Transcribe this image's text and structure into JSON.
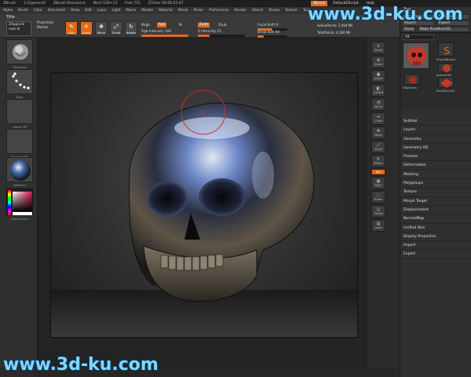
{
  "app": {
    "title_segments": [
      "ZBrush",
      "3.1[general]",
      "ZBrush Document",
      "Mem 539+13",
      "Free 751",
      "ZTimer 00:00:03.87"
    ],
    "menus_button": "Menus",
    "default_script": "DefaultZScript",
    "help": "Help"
  },
  "menubar": {
    "items": [
      "Alpha",
      "Brush",
      "Color",
      "Document",
      "Draw",
      "Edit",
      "Layer",
      "Light",
      "Macro",
      "Marker",
      "Material",
      "Movie",
      "Picker",
      "Preferences",
      "Render",
      "Stencil",
      "Stroke",
      "Texture",
      "Tool"
    ]
  },
  "shelf": {
    "title": "Title",
    "zapp_line1": "ZAppLink",
    "zapp_line2": "new dl",
    "proj_line1": "Projection",
    "proj_line2": "Master",
    "buttons": [
      {
        "label": "Edit",
        "icon": "✎",
        "active": true
      },
      {
        "label": "Draw",
        "icon": "✛",
        "active": true
      },
      {
        "label": "Move",
        "icon": "✥",
        "active": false
      },
      {
        "label": "Scale",
        "icon": "⤢",
        "active": false
      },
      {
        "label": "Rotate",
        "icon": "↻",
        "active": false
      }
    ],
    "mrgb": "Mrgb",
    "rgb": "Rgb",
    "m": "M",
    "rgb_intensity": "Rgb Intensity 100",
    "zadd": "Zadd",
    "zsub": "Zsub",
    "z_intensity": "Z Intensity 25",
    "focal_shift": "Focal Shift 0",
    "draw_size": "Draw Size 64",
    "active_points": "ActivePoints: 2.004 Mil",
    "total_points": "TotalPoints: 4.280 Mil"
  },
  "left_tray": {
    "tiles": [
      "Standard",
      "Dots",
      "Alpha Off",
      "Texture Off",
      "Material"
    ],
    "switch_color": "SwitchColor"
  },
  "right_shelf": {
    "buttons": [
      {
        "label": "Scroll",
        "icon": "⇕"
      },
      {
        "label": "Zoom",
        "icon": "⊕"
      },
      {
        "label": "Actual",
        "icon": "▣"
      },
      {
        "label": "AAHalf",
        "icon": "◧"
      },
      {
        "label": "Persp",
        "icon": "◔"
      },
      {
        "label": "L.Sym",
        "icon": "⇔"
      },
      {
        "label": "Move",
        "icon": "✥"
      },
      {
        "label": "Scale",
        "icon": "⤢"
      },
      {
        "label": "Rotate",
        "icon": "↻"
      },
      {
        "label": "PolyF",
        "icon": "▦"
      },
      {
        "label": "Frame",
        "icon": "⬚"
      },
      {
        "label": "Transp",
        "icon": "◫"
      },
      {
        "label": "Layer",
        "icon": "▤"
      }
    ],
    "xyz_label": "Xyz"
  },
  "right_panel": {
    "title": "Tool",
    "load": "Load Tool",
    "save": "Save As",
    "import": "Import",
    "export": "Export",
    "clone": "Clone",
    "make_poly": "Make PolyMesh3D",
    "subtool_value": "48",
    "subtools": [
      "SimpleBrush",
      "Sphere3D",
      "ZSpheres",
      "PolyMesh3D"
    ],
    "sections": [
      "Subtool",
      "Layers",
      "Geometry",
      "Geometry HD",
      "Preview",
      "Deformation",
      "Masking",
      "Polygroups",
      "Texture",
      "Morph Target",
      "Displacement",
      "NormalMap",
      "Unified Skin",
      "Display Properties",
      "Import",
      "Export"
    ]
  },
  "watermarks": {
    "top": "www.3d-ku.com",
    "bottom": "www.3d-ku.com"
  },
  "colors": {
    "accent": "#e06b1a",
    "bg": "#2b2b2b"
  }
}
